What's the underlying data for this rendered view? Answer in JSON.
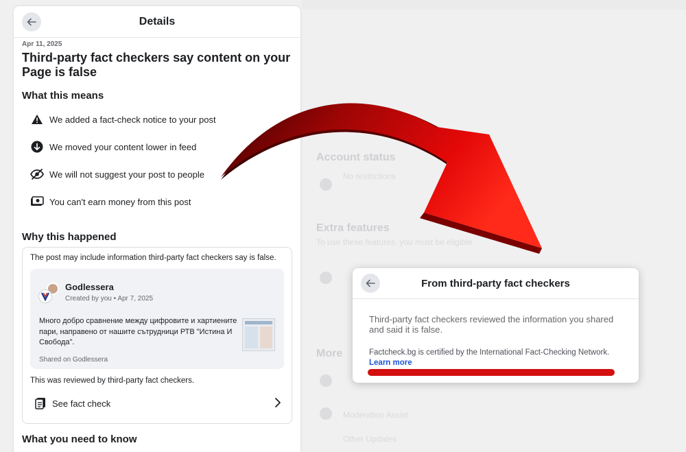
{
  "background": {
    "account_status": "Account status",
    "no_restrictions": "No restrictions",
    "extra_features": "Extra features",
    "extra_desc": "To use these features, you must be eligible",
    "more": "More",
    "moderation_assist": "Moderation Assist",
    "other_updates": "Other Updates"
  },
  "details": {
    "title": "Details",
    "date": "Apr 11, 2025",
    "headline": "Third-party fact checkers say content on your Page is false",
    "what_means_title": "What this means",
    "impacts": [
      {
        "icon": "warning-icon",
        "text": "We added a fact-check notice to your post"
      },
      {
        "icon": "arrow-down-circle-icon",
        "text": "We moved your content lower in feed"
      },
      {
        "icon": "eye-slash-icon",
        "text": "We will not suggest your post to people"
      },
      {
        "icon": "money-off-icon",
        "text": "You can't earn money from this post"
      }
    ],
    "why_title": "Why this happened",
    "post_intro": "The post may include information third-party fact checkers say is false.",
    "post": {
      "author": "Godlessera",
      "created": "Created by you • Apr 7, 2025",
      "text": "Много добро сравнение между цифровите и хартиените пари, направено от нашите сътрудници РТВ \"Истина И Свобода\".",
      "shared_on": "Shared on Godlessera"
    },
    "reviewed": "This was reviewed by third-party fact checkers.",
    "see_fact_check": "See fact check",
    "need_to_know_title": "What you need to know"
  },
  "popup": {
    "title": "From third-party fact checkers",
    "body": "Third-party fact checkers reviewed the information you shared and said it is false.",
    "certified": "Factcheck.bg is certified by the International Fact-Checking Network.",
    "learn_more": "Learn more"
  },
  "colors": {
    "arrow_red": "#e00a0a",
    "arrow_dark": "#4a0000",
    "link_blue": "#1b57d6"
  }
}
